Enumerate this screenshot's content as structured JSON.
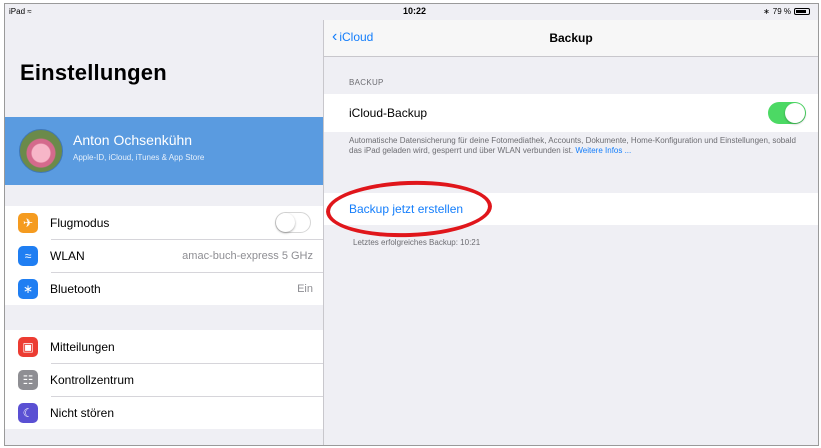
{
  "status_bar": {
    "device": "iPad",
    "time": "10:22",
    "battery": "79 %"
  },
  "master": {
    "title": "Einstellungen",
    "profile": {
      "name": "Anton Ochsenkühn",
      "subtitle": "Apple-ID, iCloud, iTunes & App Store"
    },
    "group1": [
      {
        "label": "Flugmodus",
        "icon": "airplane-icon",
        "color": "#f59b1f",
        "toggle": false
      },
      {
        "label": "WLAN",
        "icon": "wifi-icon",
        "color": "#1f7ef2",
        "value": "amac-buch-express 5 GHz"
      },
      {
        "label": "Bluetooth",
        "icon": "bluetooth-icon",
        "color": "#1f7ef2",
        "value": "Ein"
      }
    ],
    "group2": [
      {
        "label": "Mitteilungen",
        "icon": "notifications-icon",
        "color": "#ec3c32"
      },
      {
        "label": "Kontrollzentrum",
        "icon": "control-center-icon",
        "color": "#8e8e93"
      },
      {
        "label": "Nicht stören",
        "icon": "moon-icon",
        "color": "#5a50d3"
      }
    ]
  },
  "detail": {
    "back_label": "iCloud",
    "title": "Backup",
    "section_header": "BACKUP",
    "icloud_backup_label": "iCloud-Backup",
    "icloud_backup_on": true,
    "footer_text": "Automatische Datensicherung für deine Fotomediathek, Accounts, Dokumente, Home-Konfiguration und Einstellungen, sobald das iPad geladen wird, gesperrt und über WLAN verbunden ist.",
    "footer_link": "Weitere Infos ...",
    "backup_now_label": "Backup jetzt erstellen",
    "last_backup": "Letztes erfolgreiches Backup: 10:21"
  },
  "colors": {
    "accent": "#147efb",
    "toggle_on": "#4cd964",
    "profile_bg": "#5a9be0",
    "annotation": "#e0161b"
  }
}
